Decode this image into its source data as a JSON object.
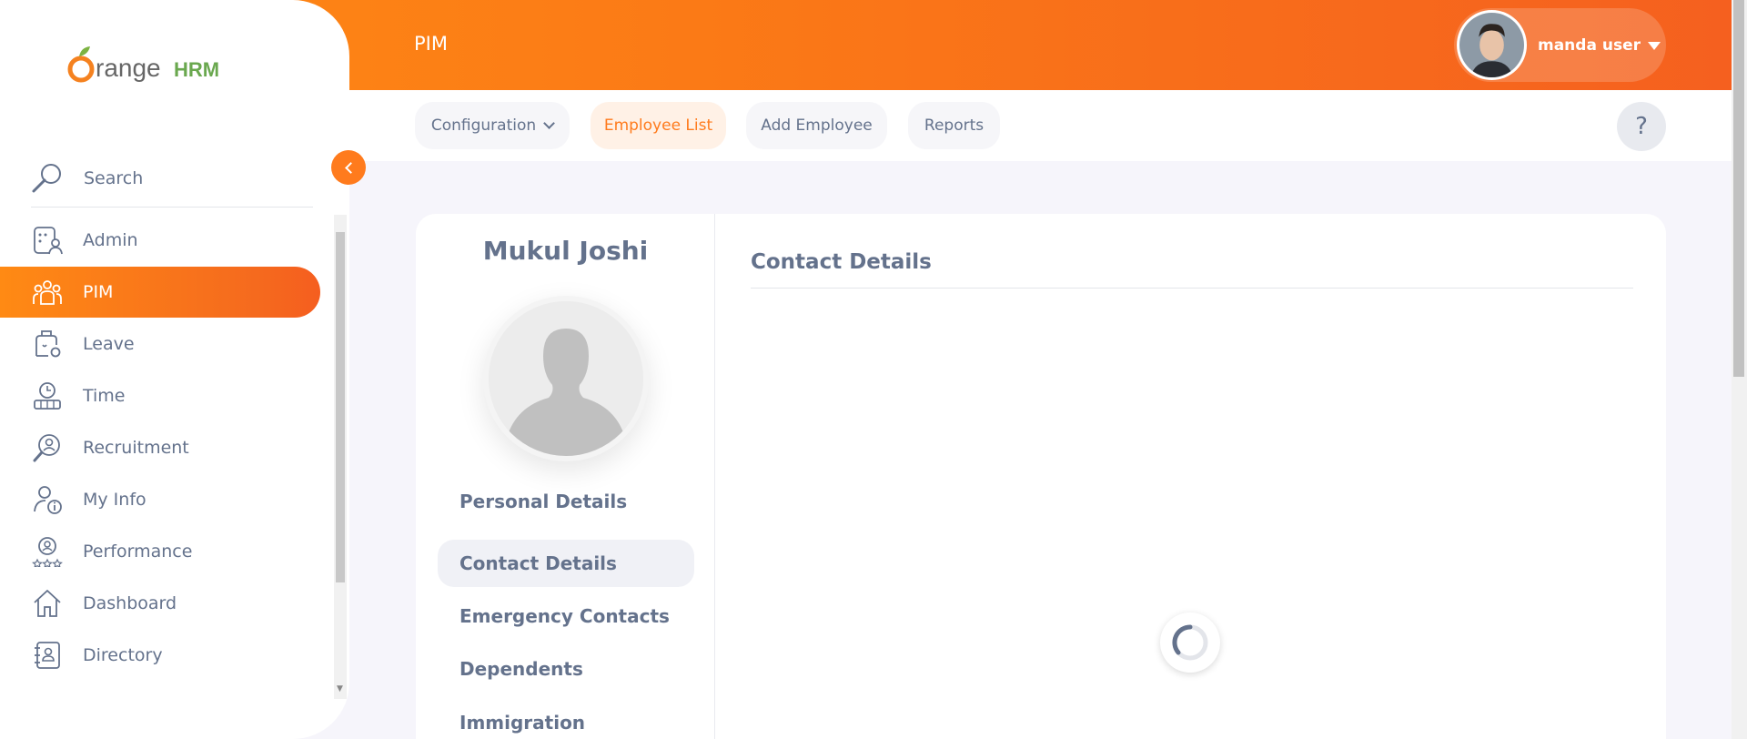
{
  "header": {
    "module_title": "PIM",
    "user_name": "manda user"
  },
  "topnav": {
    "items": [
      {
        "label": "Configuration",
        "has_dropdown": true
      },
      {
        "label": "Employee List",
        "active": true
      },
      {
        "label": "Add Employee"
      },
      {
        "label": "Reports"
      }
    ],
    "help_label": "?"
  },
  "sidebar": {
    "brand": {
      "part1": "range",
      "part2": "HRM"
    },
    "search_label": "Search",
    "items": [
      {
        "label": "Admin",
        "icon": "admin-icon"
      },
      {
        "label": "PIM",
        "icon": "pim-icon",
        "active": true
      },
      {
        "label": "Leave",
        "icon": "leave-icon"
      },
      {
        "label": "Time",
        "icon": "time-icon"
      },
      {
        "label": "Recruitment",
        "icon": "recruitment-icon"
      },
      {
        "label": "My Info",
        "icon": "my-info-icon"
      },
      {
        "label": "Performance",
        "icon": "performance-icon"
      },
      {
        "label": "Dashboard",
        "icon": "dashboard-icon"
      },
      {
        "label": "Directory",
        "icon": "directory-icon"
      }
    ]
  },
  "employee": {
    "name": "Mukul Joshi"
  },
  "profile_tabs": [
    {
      "label": "Personal Details"
    },
    {
      "label": "Contact Details",
      "active": true
    },
    {
      "label": "Emergency Contacts"
    },
    {
      "label": "Dependents"
    },
    {
      "label": "Immigration"
    }
  ],
  "content": {
    "title": "Contact Details"
  },
  "colors": {
    "accent": "#ff7b1d",
    "text": "#64728c"
  }
}
